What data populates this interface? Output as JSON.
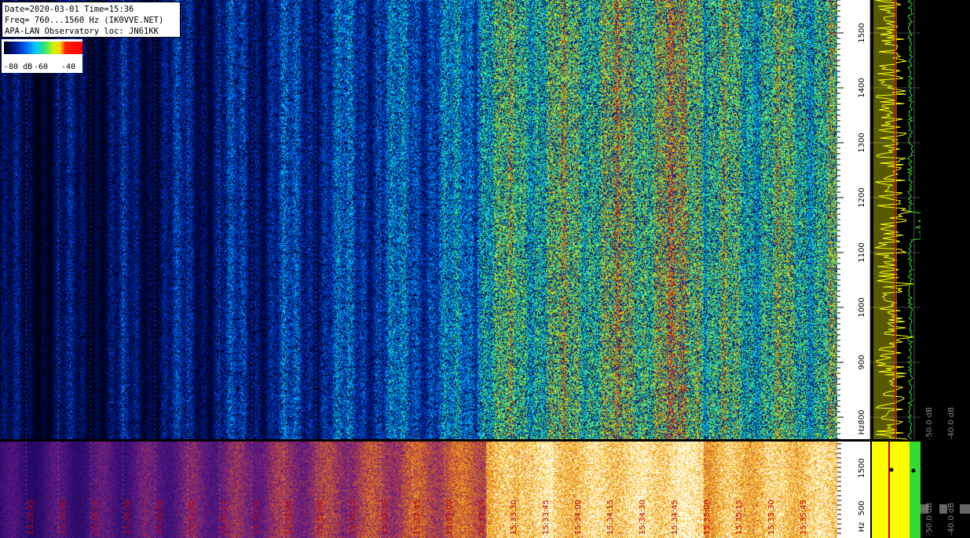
{
  "info": {
    "line1": "Date=2020-03-01 Time=15:36",
    "line2": "Freq= 760...1560 Hz (IK0VVE.NET)",
    "line3": "APA-LAN Observatory loc: JN61KK"
  },
  "legend": {
    "label_left": "-80 dB",
    "label_mid": "-60",
    "label_right": "-40"
  },
  "colors": {
    "spectrum_yellow": "#ffff00",
    "spectrum_green": "#32dc32",
    "peak_red": "#c80000",
    "time_label": "#c80000"
  },
  "chart_data": [
    {
      "type": "heatmap",
      "name_note": "spectrogram (waterfall)",
      "y_ticks": [
        "800",
        "900",
        "1000",
        "1100",
        "1200",
        "1300",
        "1400",
        "1500"
      ],
      "y_unit": "Hz",
      "ylim": [
        760,
        1560
      ],
      "spectrum_labels": [
        "-50.0 dB",
        "-40.0 dB"
      ]
    },
    {
      "type": "heatmap",
      "name_note": "wide spectrogram",
      "y_ticks": [
        "500",
        "1500"
      ],
      "y_unit": "Hz",
      "x_tick_labels": [
        "15:29:45",
        "15:30:00",
        "15:30:15",
        "15:30:30",
        "15:30:45",
        "15:31:00",
        "15:31:15",
        "15:31:30",
        "15:31:45",
        "15:32:00",
        "15:32:15",
        "15:32:30",
        "15:32:45",
        "15:33:00",
        "15:33:15",
        "15:33:30",
        "15:33:45",
        "15:34:00",
        "15:34:15",
        "15:34:30",
        "15:34:45",
        "15:35:00",
        "15:35:15",
        "15:35:30",
        "15:35:45"
      ],
      "spectrum_labels": [
        "-50.0 dB",
        "-40.0 dB"
      ]
    }
  ]
}
